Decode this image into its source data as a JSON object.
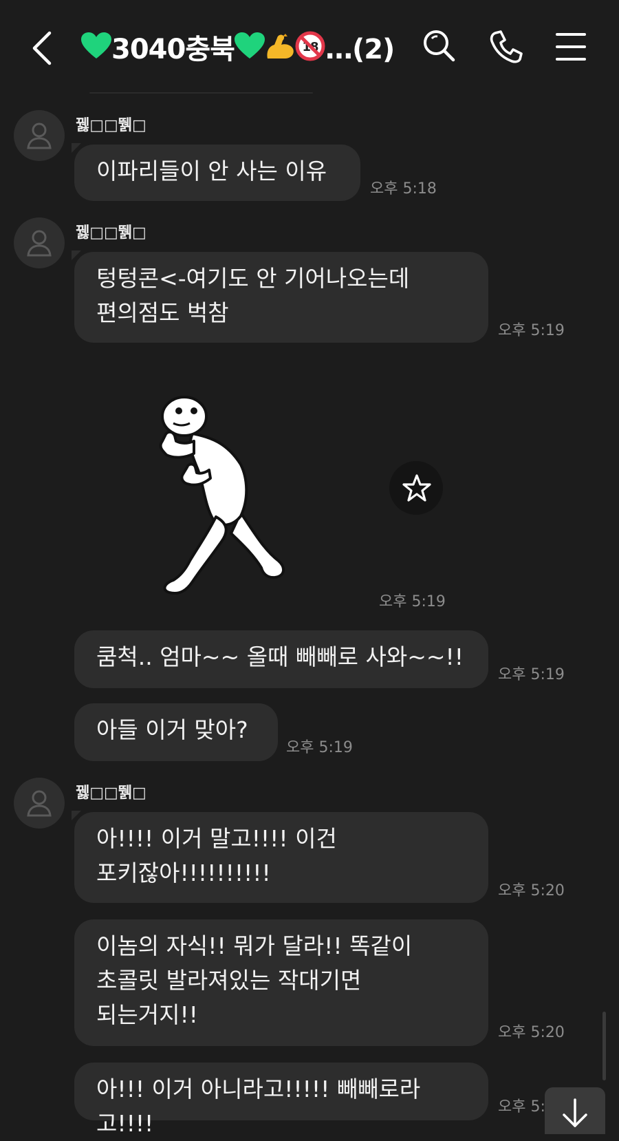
{
  "header": {
    "title_prefix_emoji": "green-heart",
    "title_text": "3040충북",
    "title_suffix_emojis": [
      "green-heart",
      "flexed-biceps",
      "no-one-under-eighteen"
    ],
    "ellipsis": "…",
    "member_count": "(2)",
    "icons": [
      "back-icon",
      "search-icon",
      "phone-icon",
      "menu-icon"
    ]
  },
  "messages": [
    {
      "sender": "꿿□□뛝□",
      "text": "이파리들이 안 사는 이유",
      "time": "오후 5:18"
    },
    {
      "sender": "꿿□□뛝□",
      "text": "텅텅콘<-여기도 안 기어나오는데\n편의점도 벅참",
      "time": "오후 5:19"
    },
    {
      "type": "sticker",
      "sticker": "white-stick-figure-thumbs-up-walking",
      "time": "오후 5:19"
    },
    {
      "text": "쿰척.. 엄마~~ 올때 빼빼로 사와~~!!",
      "time": "오후 5:19"
    },
    {
      "text": "아들 이거 맞아?",
      "time": "오후 5:19"
    },
    {
      "sender": "꿿□□뛝□",
      "text": "아!!!! 이거 말고!!!! 이건\n포키잖아!!!!!!!!!!",
      "time": "오후 5:20"
    },
    {
      "text": "이놈의 자식!! 뭐가 달라!! 똑같이\n초콜릿 발라져있는 작대기면\n되는거지!!",
      "time": "오후 5:20"
    },
    {
      "text": "아!!! 이거 아니라고!!!!! 빼빼로라고!!!!",
      "time": "오후 5:"
    }
  ],
  "colors": {
    "background": "#1c1c1c",
    "bubble": "#2d2d2d",
    "time_text": "#8c8c8c",
    "heart": "#1fd37c"
  }
}
